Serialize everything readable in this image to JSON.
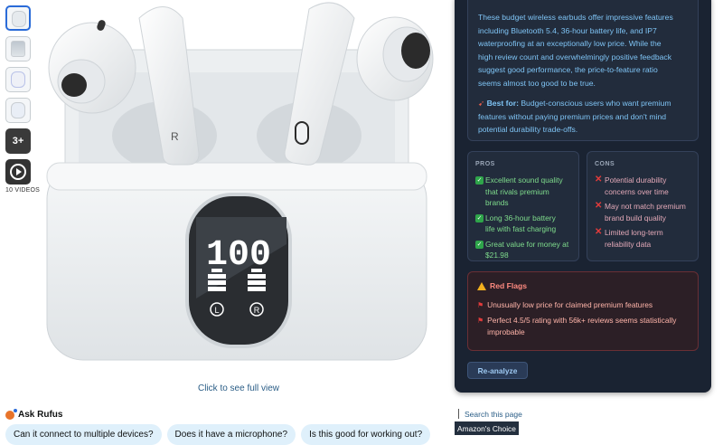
{
  "gallery": {
    "more_count": "3+",
    "videos_label": "10 VIDEOS",
    "click_full_view": "Click to see full view",
    "case_display_digits": "100",
    "left_bud_letter": "L",
    "right_bud_letter": "R"
  },
  "rufus": {
    "title": "Ask Rufus",
    "chips": [
      "Can it connect to multiple devices?",
      "Does it have a microphone?",
      "Is this good for working out?"
    ]
  },
  "analysis": {
    "summary_lines": [
      "These budget wireless earbuds offer impressive features",
      "including Bluetooth 5.4, 36-hour battery life, and IP7",
      "waterproofing at an exceptionally low price. While the",
      "high review count and overwhelmingly positive feedback",
      "suggest good performance, the price-to-feature ratio",
      "seems almost too good to be true."
    ],
    "best_for_label": "Best for:",
    "best_for_lines": [
      " Budget-conscious users who want premium",
      "features without paying premium prices and don't mind",
      "potential durability trade-offs."
    ],
    "pros_title": "PROS",
    "pros": [
      [
        "Excellent sound quality",
        "that rivals premium brands"
      ],
      [
        "Long 36-hour battery",
        "life with fast charging"
      ],
      [
        "Great value for money at",
        "$21.98"
      ]
    ],
    "cons_title": "CONS",
    "cons": [
      [
        "Potential durability",
        "concerns over time"
      ],
      [
        "May not match premium",
        "brand build quality"
      ],
      [
        "Limited long-term",
        "reliability data"
      ]
    ],
    "red_flags_title": "Red Flags",
    "red_flags": [
      [
        "Unusually low price for claimed premium features"
      ],
      [
        "Perfect 4.5/5 rating with 56k+ reviews seems statistically",
        "improbable"
      ]
    ],
    "reanalyze_label": "Re-analyze"
  },
  "search_this_page": "Search this page",
  "badge": "Amazon's Choice",
  "colors": {
    "panel_bg": "#1a2332",
    "card_bg": "#222c3c",
    "accent_text": "#7fc4f5",
    "pros_text": "#7fdc8c",
    "cons_text": "#e3a9b8",
    "red_flag_text": "#ffb4a9",
    "chip_bg": "#dff0fb"
  }
}
